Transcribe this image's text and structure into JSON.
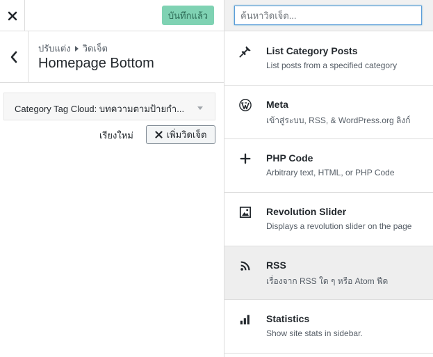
{
  "topbar": {
    "close_icon": "close-icon",
    "saved_label": "บันทึกแล้ว",
    "saved_color": "#7fd2b3"
  },
  "section": {
    "back_icon": "chevron-left-icon",
    "crumb_parent": "ปรับแต่ง",
    "crumb_child": "วิดเจ็ต",
    "title": "Homepage Bottom"
  },
  "widget": {
    "title": "Category Tag Cloud: บทความตามป้ายกำ...",
    "arrow_icon": "triangle-down-icon"
  },
  "actions": {
    "reorder_label": "เรียงใหม่",
    "add_label": "เพิ่มวิดเจ็ต"
  },
  "search": {
    "placeholder": "ค้นหาวิดเจ็ต...",
    "value": ""
  },
  "available_widgets": [
    {
      "icon": "pushpin-icon",
      "name": "List Category Posts",
      "desc": "List posts from a specified category"
    },
    {
      "icon": "wordpress-icon",
      "name": "Meta",
      "desc": "เข้าสู่ระบบ, RSS, & WordPress.org ลิงก์"
    },
    {
      "icon": "plus-icon",
      "name": "PHP Code",
      "desc": "Arbitrary text, HTML, or PHP Code"
    },
    {
      "icon": "image-icon",
      "name": "Revolution Slider",
      "desc": "Displays a revolution slider on the page"
    },
    {
      "icon": "rss-icon",
      "name": "RSS",
      "desc": "เรื่องจาก RSS ใด ๆ หรือ Atom ฟีด",
      "highlighted": true
    },
    {
      "icon": "bar-chart-icon",
      "name": "Statistics",
      "desc": "Show site stats in sidebar."
    }
  ]
}
